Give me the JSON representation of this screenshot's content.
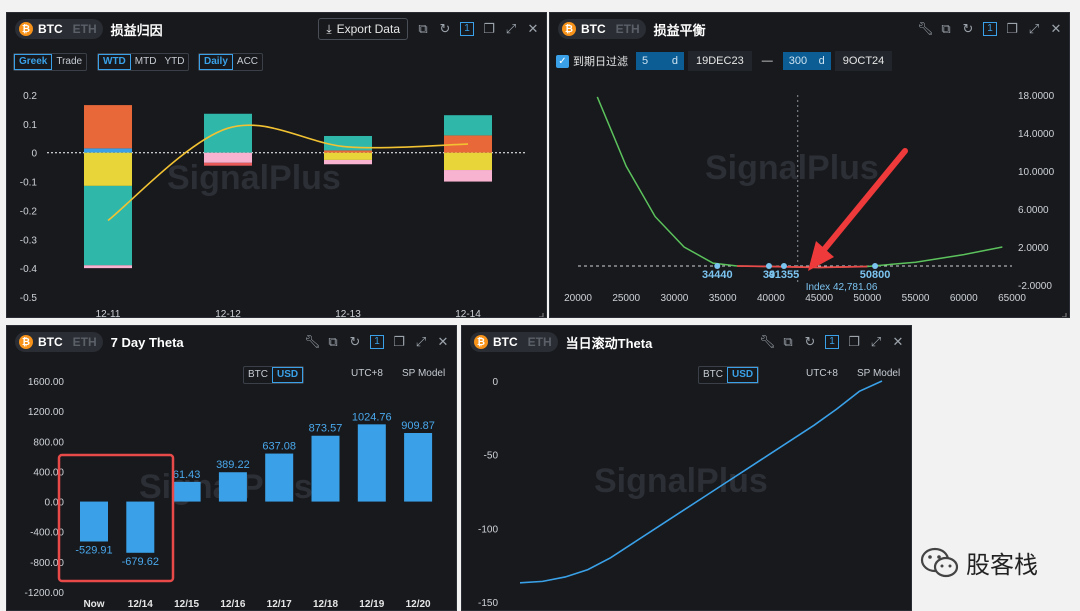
{
  "coin": {
    "btc": "BTC",
    "eth": "ETH",
    "btc_glyph": "₿"
  },
  "panel1": {
    "title": "损益归因",
    "export_label": "Export Data",
    "toggles1": [
      "Greek",
      "Trade"
    ],
    "toggles2": [
      "WTD",
      "MTD",
      "YTD"
    ],
    "toggles3": [
      "Daily",
      "ACC"
    ],
    "page_num": "1",
    "watermark": "SignalPlus"
  },
  "panel2": {
    "title": "损益平衡",
    "filter_label": "到期日过滤",
    "from_val": "5",
    "from_unit": "d",
    "from_date": "19DEC23",
    "dash": "—",
    "to_val": "300",
    "to_unit": "d",
    "to_date": "9OCT24",
    "page_num": "1",
    "index_label": "Index 42,781.06",
    "watermark": "SignalPlus"
  },
  "panel3": {
    "title": "7 Day Theta",
    "btc_label": "BTC",
    "usd_label": "USD",
    "tz": "UTC+8",
    "model": "SP Model",
    "page_num": "1",
    "watermark": "SignalPlus"
  },
  "panel4": {
    "title": "当日滚动Theta",
    "btc_label": "BTC",
    "usd_label": "USD",
    "tz": "UTC+8",
    "model": "SP Model",
    "page_num": "1",
    "watermark": "SignalPlus"
  },
  "wechat": {
    "label": "股客栈"
  },
  "chart_data": [
    {
      "type": "bar",
      "stacked": true,
      "categories": [
        "12-11",
        "12-12",
        "12-13",
        "12-14"
      ],
      "ylim": [
        -0.5,
        0.2
      ],
      "yticks": [
        "0.2",
        "0.1",
        "0",
        "-0.1",
        "-0.2",
        "-0.3",
        "-0.4",
        "-0.5"
      ],
      "series": [
        {
          "color": "#3aa1e8",
          "values": [
            0.015,
            0,
            0,
            0
          ]
        },
        {
          "color": "#e8683a",
          "values": [
            0.15,
            0,
            0.008,
            0.06
          ]
        },
        {
          "color": "#e8d53a",
          "values": [
            -0.115,
            0,
            -0.025,
            -0.06
          ]
        },
        {
          "color": "#2fb8aa",
          "values": [
            -0.275,
            0.135,
            0.05,
            0.07
          ]
        },
        {
          "color": "#f7b3d0",
          "values": [
            -0.01,
            -0.035,
            -0.015,
            -0.04
          ]
        },
        {
          "color": "#e85a5a",
          "values": [
            0,
            -0.01,
            0,
            0
          ]
        }
      ],
      "line": {
        "color": "#f2c233",
        "values": [
          -0.235,
          0.085,
          0.02,
          0.03
        ]
      }
    },
    {
      "type": "line",
      "xlim": [
        20000,
        65000
      ],
      "xticks": [
        "20000",
        "25000",
        "30000",
        "35000",
        "40000",
        "45000",
        "50000",
        "55000",
        "60000",
        "65000"
      ],
      "ylim": [
        -2,
        18
      ],
      "yticks": [
        "18.0000",
        "14.0000",
        "10.0000",
        "6.0000",
        "2.0000",
        "-2.0000"
      ],
      "curve": [
        [
          22000,
          17.8
        ],
        [
          25000,
          10.5
        ],
        [
          28000,
          5.2
        ],
        [
          31000,
          2.0
        ],
        [
          34000,
          0.3
        ],
        [
          36500,
          0
        ],
        [
          40000,
          -0.05
        ],
        [
          45000,
          -0.15
        ],
        [
          50000,
          -0.05
        ],
        [
          55000,
          0.4
        ],
        [
          60000,
          1.2
        ],
        [
          64000,
          2.0
        ]
      ],
      "breakevens": [
        {
          "x": 34440,
          "label": "34440"
        },
        {
          "x": 39800,
          "label": "39"
        },
        {
          "x": 41355,
          "label": "41355"
        },
        {
          "x": 50800,
          "label": "50800"
        }
      ],
      "index": 42781.06
    },
    {
      "type": "bar",
      "categories": [
        "Now",
        "12/14",
        "12/15",
        "12/16",
        "12/17",
        "12/18",
        "12/19",
        "12/20"
      ],
      "values": [
        -529.91,
        -679.62,
        261.43,
        389.22,
        637.08,
        873.57,
        1024.76,
        909.87
      ],
      "labels": [
        "-529.91",
        "-679.62",
        "61.43",
        "389.22",
        "637.08",
        "873.57",
        "1024.76",
        "909.87"
      ],
      "ylim": [
        -1200,
        1600
      ],
      "yticks": [
        "1600.00",
        "1200.00",
        "800.00",
        "400.00",
        "0.00",
        "-400.00",
        "-800.00",
        "-1200.00"
      ],
      "color": "#3aa1e8"
    },
    {
      "type": "line",
      "ylim": [
        -150,
        0
      ],
      "yticks": [
        "0",
        "-50",
        "-100",
        "-150"
      ],
      "values": [
        -137,
        -136,
        -133,
        -128,
        -120,
        -110,
        -100,
        -90,
        -80,
        -70,
        -60,
        -50,
        -40,
        -30,
        -19,
        -7,
        0
      ],
      "color": "#3aa1e8"
    }
  ]
}
